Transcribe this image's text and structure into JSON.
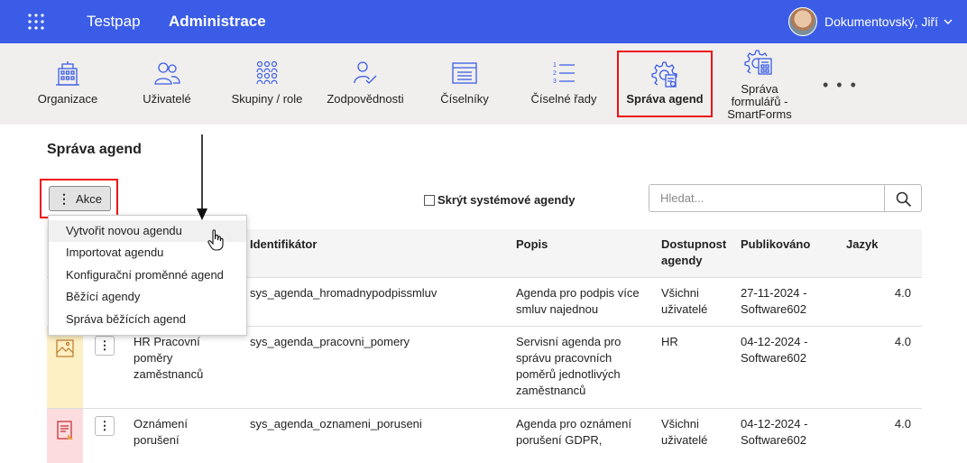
{
  "header": {
    "brand": "Testpap",
    "section": "Administrace",
    "user_name": "Dokumentovský, Jiří"
  },
  "toolbar": {
    "items": [
      {
        "label": "Organizace",
        "icon": "building-icon"
      },
      {
        "label": "Uživatelé",
        "icon": "users-icon"
      },
      {
        "label": "Skupiny / role",
        "icon": "groups-icon"
      },
      {
        "label": "Zodpovědnosti",
        "icon": "user-check-icon"
      },
      {
        "label": "Číselníky",
        "icon": "list-window-icon"
      },
      {
        "label": "Číselné řady",
        "icon": "numbered-list-icon"
      },
      {
        "label": "Správa agend",
        "icon": "gear-document-icon"
      },
      {
        "label": "Správa formulářů - SmartForms",
        "icon": "gear-form-icon"
      }
    ],
    "more": "• • •"
  },
  "page": {
    "title": "Správa agend",
    "akce_label": "Akce",
    "hide_system_label": "Skrýt systémové agendy",
    "search_placeholder": "Hledat..."
  },
  "dropdown": {
    "items": [
      "Vytvořit novou agendu",
      "Importovat agendu",
      "Konfigurační proměnné agend",
      "Běžící agendy",
      "Správa běžících agend"
    ]
  },
  "table": {
    "headers": {
      "identifier": "Identifikátor",
      "description": "Popis",
      "availability_1": "Dostupnost",
      "availability_2": "agendy",
      "published": "Publikováno",
      "language": "Jazyk"
    },
    "rows": [
      {
        "name": [],
        "identifier": "sys_agenda_hromadnypodpissmluv",
        "description": [
          "Agenda pro podpis více",
          "smluv najednou"
        ],
        "availability": [
          "Všichni",
          "uživatelé"
        ],
        "published": [
          "27-11-2024 -",
          "Software602"
        ],
        "version": "4.0",
        "color": "#ffffff"
      },
      {
        "name": [
          "HR Pracovní",
          "poměry",
          "zaměstnanců"
        ],
        "identifier": "sys_agenda_pracovni_pomery",
        "description": [
          "Servisní agenda pro",
          "správu pracovních",
          "poměrů jednotlivých",
          "zaměstnanců"
        ],
        "availability": [
          "HR"
        ],
        "published": [
          "04-12-2024 -",
          "Software602"
        ],
        "version": "4.0",
        "color": "#fdf0c4"
      },
      {
        "name": [
          "Oznámení",
          "porušení"
        ],
        "identifier": "sys_agenda_oznameni_poruseni",
        "description": [
          "Agenda pro oznámení",
          "porušení GDPR,"
        ],
        "availability": [
          "Všichni",
          "uživatelé"
        ],
        "published": [
          "04-12-2024 -",
          "Software602"
        ],
        "version": "4.0",
        "color": "#fcdcdf"
      }
    ]
  },
  "colors": {
    "topbar": "#3b5ce6",
    "toolbar_bg": "#f0efee",
    "highlight": "#e11111"
  }
}
